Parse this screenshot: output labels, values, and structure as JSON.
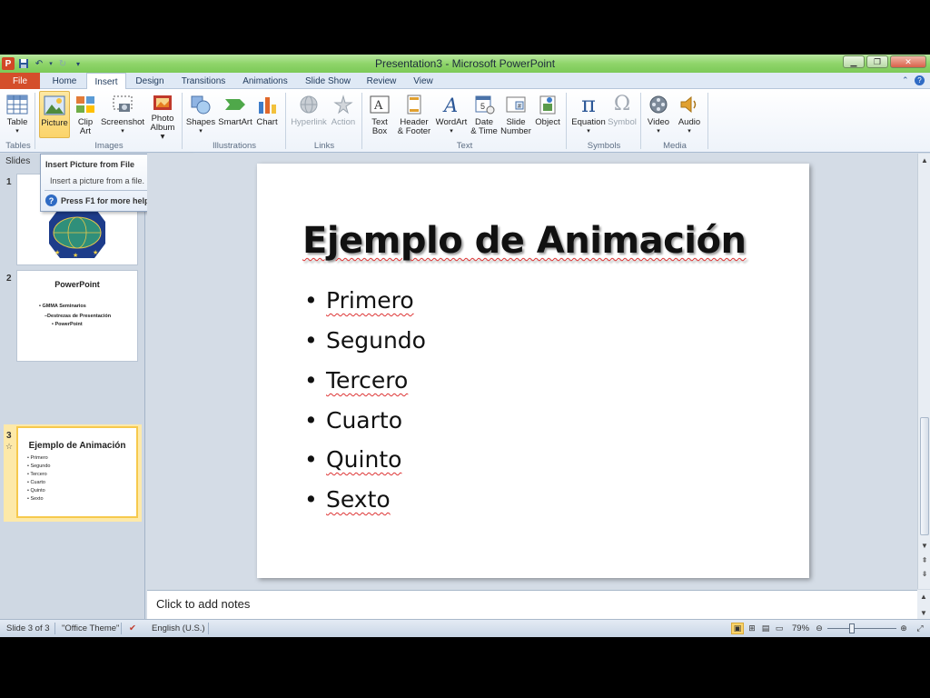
{
  "window": {
    "title": "Presentation3 - Microsoft PowerPoint"
  },
  "colors": {
    "accent": "#d44e2b",
    "titlebar": "#8fd56a",
    "selection": "#fbd46a"
  },
  "tabs": [
    "File",
    "Home",
    "Insert",
    "Design",
    "Transitions",
    "Animations",
    "Slide Show",
    "Review",
    "View"
  ],
  "ribbon": {
    "table": "Table",
    "picture": "Picture",
    "clip_art_1": "Clip",
    "clip_art_2": "Art",
    "screenshot": "Screenshot",
    "photo_album_1": "Photo",
    "photo_album_2": "Album",
    "shapes": "Shapes",
    "smartart": "SmartArt",
    "chart": "Chart",
    "hyperlink": "Hyperlink",
    "action": "Action",
    "text_box_1": "Text",
    "text_box_2": "Box",
    "header_footer_1": "Header",
    "header_footer_2": "& Footer",
    "wordart": "WordArt",
    "date_time_1": "Date",
    "date_time_2": "& Time",
    "slide_number_1": "Slide",
    "slide_number_2": "Number",
    "object": "Object",
    "equation": "Equation",
    "symbol": "Symbol",
    "video": "Video",
    "audio": "Audio",
    "groups": {
      "tables": "Tables",
      "images": "Images",
      "illustrations": "Illustrations",
      "links": "Links",
      "text": "Text",
      "symbols": "Symbols",
      "media": "Media"
    }
  },
  "tooltip": {
    "title": "Insert Picture from File",
    "description": "Insert a picture from a file.",
    "help": "Press F1 for more help."
  },
  "left_panel": {
    "tab_label": "Slides",
    "thumbnails": [
      {
        "number": "1"
      },
      {
        "number": "2",
        "title": "PowerPoint",
        "lines": [
          "• GMMA Seminarios",
          "–Destrezas de Presentación",
          "• PowerPoint"
        ]
      },
      {
        "number": "3",
        "title": "Ejemplo de Animación",
        "lines": [
          "• Primero",
          "• Segundo",
          "• Tercero",
          "• Cuarto",
          "• Quinto",
          "• Sexto"
        ]
      }
    ]
  },
  "slide": {
    "title": "Ejemplo de Animación",
    "bullets": [
      "Primero",
      "Segundo",
      "Tercero",
      "Cuarto",
      "Quinto",
      "Sexto"
    ]
  },
  "notes": {
    "placeholder": "Click to add notes"
  },
  "status": {
    "slide_info": "Slide 3 of 3",
    "theme": "\"Office Theme\"",
    "language": "English (U.S.)",
    "zoom": "79%"
  }
}
